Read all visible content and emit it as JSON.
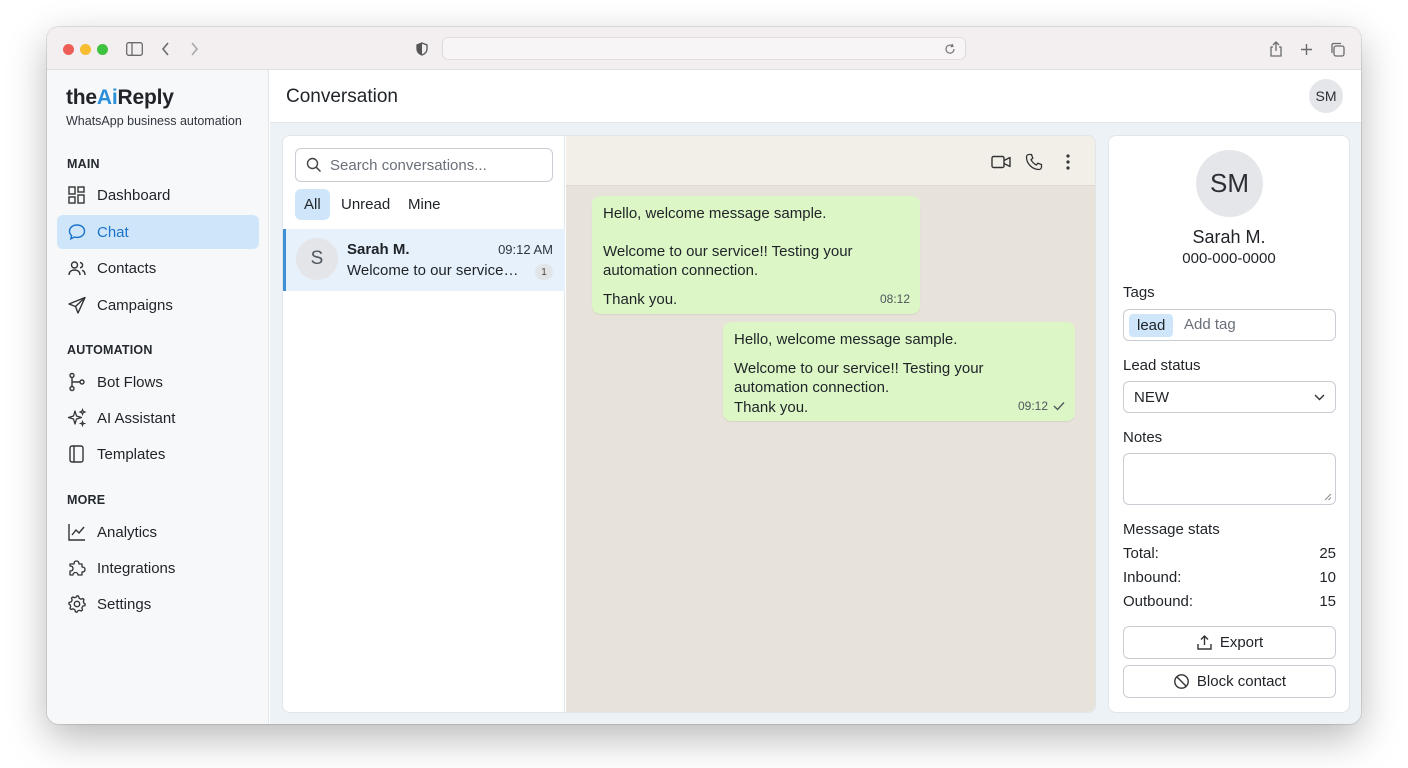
{
  "app": {
    "brand_prefix": "the",
    "brand_ai": "Ai",
    "brand_suffix": "Reply",
    "tagline": "WhatsApp business automation",
    "accent_color": "#2b8fd9",
    "bubble_color": "#dcf6c6"
  },
  "sidebar": {
    "sections": [
      {
        "title": "MAIN",
        "items": [
          {
            "label": "Dashboard",
            "icon": "dashboard-icon"
          },
          {
            "label": "Chat",
            "icon": "chat-icon",
            "active": true
          },
          {
            "label": "Contacts",
            "icon": "contacts-icon"
          },
          {
            "label": "Campaigns",
            "icon": "megaphone-icon"
          }
        ]
      },
      {
        "title": "AUTOMATION",
        "items": [
          {
            "label": "Bot Flows",
            "icon": "flow-icon"
          },
          {
            "label": "AI Assistant",
            "icon": "sparkles-icon"
          },
          {
            "label": "Templates",
            "icon": "template-icon"
          }
        ]
      },
      {
        "title": "MORE",
        "items": [
          {
            "label": "Analytics",
            "icon": "chart-icon"
          },
          {
            "label": "Integrations",
            "icon": "puzzle-icon"
          },
          {
            "label": "Settings",
            "icon": "gear-icon"
          }
        ]
      }
    ]
  },
  "header": {
    "title": "Conversation",
    "user_initials": "SM"
  },
  "conversations": {
    "search_placeholder": "Search conversations...",
    "filters": [
      "All",
      "Unread",
      "Mine"
    ],
    "active_filter": "All",
    "items": [
      {
        "initial": "S",
        "name": "Sarah M.",
        "time": "09:12 AM",
        "preview": "Welcome to our service!! Testing your automation connection.",
        "unread": "1"
      }
    ]
  },
  "chat": {
    "messages": [
      {
        "direction": "inbound",
        "line1": "Hello, welcome message sample.",
        "line2": "Welcome to our service!! Testing your",
        "line3": "automation connection.",
        "line4": "Thank you.",
        "time": "08:12"
      },
      {
        "direction": "outbound",
        "line1": "Hello, welcome message sample.",
        "line2": "Welcome to our service!! Testing your",
        "line3": "automation connection.",
        "line4": "Thank you.",
        "time": "09:12",
        "status": "sent-check-icon"
      }
    ]
  },
  "contact": {
    "initials": "SM",
    "name": "Sarah M.",
    "phone": "000-000-0000",
    "tags_label": "Tags",
    "tags": [
      "lead"
    ],
    "tag_placeholder": "Add tag",
    "lead_status_label": "Lead status",
    "lead_status": "NEW",
    "notes_label": "Notes",
    "notes": "",
    "stats_title": "Message stats",
    "stats": [
      {
        "label": "Total:",
        "value": "25"
      },
      {
        "label": "Inbound:",
        "value": "10"
      },
      {
        "label": "Outbound:",
        "value": "15"
      }
    ],
    "export_label": "Export",
    "block_label": "Block contact"
  }
}
